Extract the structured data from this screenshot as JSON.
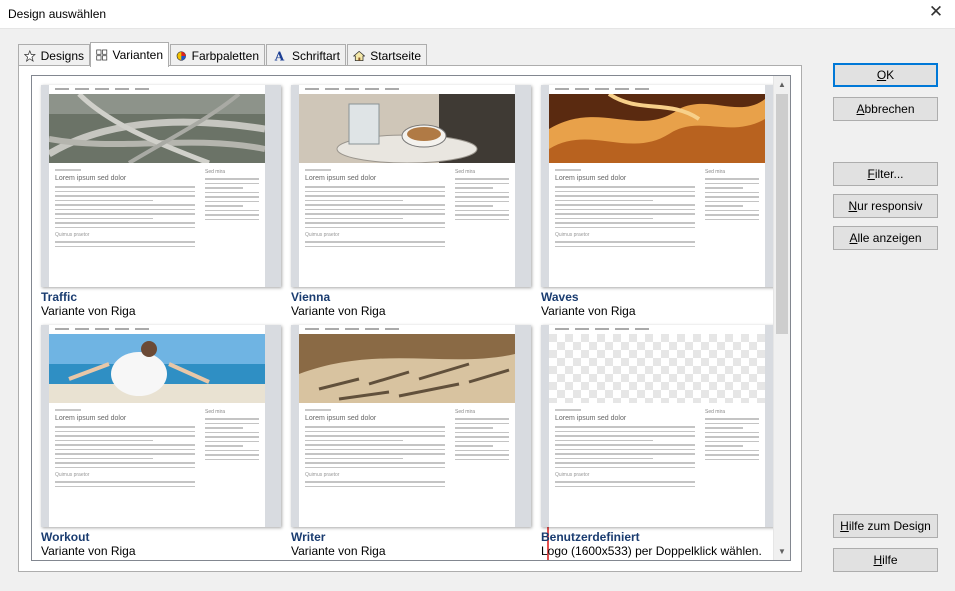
{
  "window": {
    "title": "Design auswählen",
    "close_glyph": "✕"
  },
  "tabs": [
    {
      "label": "Designs",
      "icon": "star-icon"
    },
    {
      "label": "Varianten",
      "icon": "grid-icon",
      "active": true
    },
    {
      "label": "Farbpaletten",
      "icon": "color-palette-icon"
    },
    {
      "label": "Schriftart",
      "icon": "font-icon"
    },
    {
      "label": "Startseite",
      "icon": "home-icon"
    }
  ],
  "thumb_text": {
    "heading": "Lorem ipsum sed dolor",
    "side_heading": "Sed mira",
    "sub_heading": "Quimus praetor"
  },
  "designs": [
    {
      "name": "Traffic",
      "subtitle": "Variante von Riga",
      "hero": "highway"
    },
    {
      "name": "Vienna",
      "subtitle": "Variante von Riga",
      "hero": "coffee"
    },
    {
      "name": "Waves",
      "subtitle": "Variante von Riga",
      "hero": "canyon"
    },
    {
      "name": "Workout",
      "subtitle": "Variante von Riga",
      "hero": "beach"
    },
    {
      "name": "Writer",
      "subtitle": "Variante von Riga",
      "hero": "paper"
    },
    {
      "name": "Benutzerdefiniert",
      "subtitle": "Logo (1600x533) per Doppelklick wählen.",
      "hero": "transparent",
      "selected": true
    }
  ],
  "buttons": {
    "ok": {
      "u": "O",
      "rest": "K"
    },
    "cancel": {
      "u": "A",
      "rest": "bbrechen"
    },
    "filter": {
      "u": "F",
      "rest": "ilter..."
    },
    "responsive": {
      "u": "N",
      "rest": "ur responsiv"
    },
    "show_all": {
      "u": "A",
      "rest": "lle anzeigen"
    },
    "design_help": {
      "u": "H",
      "rest": "ilfe zum Design"
    },
    "help": {
      "u": "H",
      "rest": "ilfe"
    }
  },
  "colors": {
    "title_blue": "#1a3c70",
    "selection_red": "#e45050",
    "default_button_border": "#0078d7"
  }
}
